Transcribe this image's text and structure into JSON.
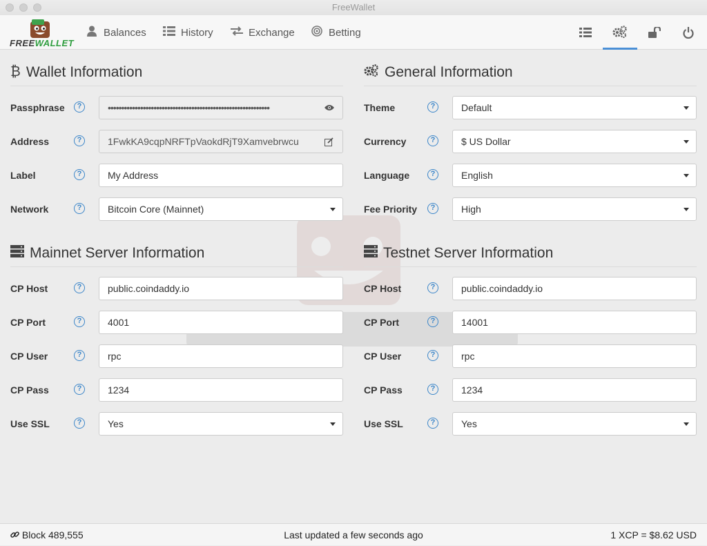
{
  "window": {
    "title": "FreeWallet"
  },
  "brand": {
    "part1": "FREE",
    "part2": "WALLET"
  },
  "nav": {
    "balances": "Balances",
    "history": "History",
    "exchange": "Exchange",
    "betting": "Betting"
  },
  "icons": {
    "balances": "user-icon",
    "history": "list-icon",
    "exchange": "exchange-icon",
    "betting": "bullseye-icon",
    "right": [
      "list-icon",
      "gears-icon",
      "unlock-icon",
      "power-icon"
    ]
  },
  "wallet": {
    "heading": "Wallet Information",
    "passphrase_label": "Passphrase",
    "passphrase_value": "••••••••••••••••••••••••••••••••••••••••••••••••••••••••••••",
    "address_label": "Address",
    "address_value": "1FwkKA9cqpNRFTpVaokdRjT9Xamvebrwcu",
    "label_label": "Label",
    "label_value": "My Address",
    "network_label": "Network",
    "network_value": "Bitcoin Core (Mainnet)"
  },
  "general": {
    "heading": "General Information",
    "theme_label": "Theme",
    "theme_value": "Default",
    "currency_label": "Currency",
    "currency_value": "$ US Dollar",
    "language_label": "Language",
    "language_value": "English",
    "fee_label": "Fee Priority",
    "fee_value": "High"
  },
  "mainnet": {
    "heading": "Mainnet Server Information",
    "host_label": "CP Host",
    "host_value": "public.coindaddy.io",
    "port_label": "CP Port",
    "port_value": "4001",
    "user_label": "CP User",
    "user_value": "rpc",
    "pass_label": "CP Pass",
    "pass_value": "1234",
    "ssl_label": "Use SSL",
    "ssl_value": "Yes"
  },
  "testnet": {
    "heading": "Testnet Server Information",
    "host_label": "CP Host",
    "host_value": "public.coindaddy.io",
    "port_label": "CP Port",
    "port_value": "14001",
    "user_label": "CP User",
    "user_value": "rpc",
    "pass_label": "CP Pass",
    "pass_value": "1234",
    "ssl_label": "Use SSL",
    "ssl_value": "Yes"
  },
  "help_glyph": "?",
  "status": {
    "block": "Block 489,555",
    "updated": "Last updated a few seconds ago",
    "rate": "1 XCP = $8.62 USD"
  },
  "colors": {
    "accent": "#4a8fd6",
    "help": "#3c86c9",
    "brand_green": "#2f9e3f"
  }
}
